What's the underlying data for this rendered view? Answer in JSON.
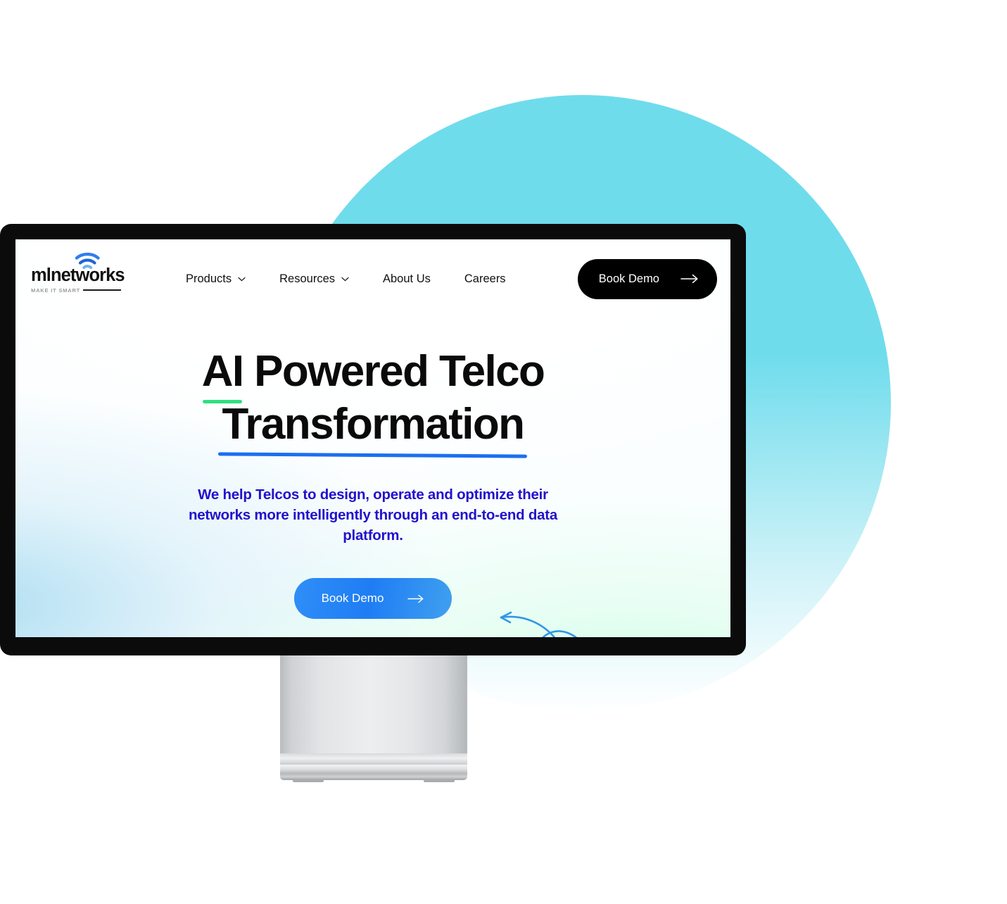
{
  "brand": {
    "name": "mlnetworks",
    "tagline": "MAKE IT SMART",
    "logo_icon": "wifi-signal-icon"
  },
  "nav": {
    "items": [
      {
        "label": "Products",
        "has_dropdown": true,
        "icon": "chevron-down-icon"
      },
      {
        "label": "Resources",
        "has_dropdown": true,
        "icon": "chevron-down-icon"
      },
      {
        "label": "About Us",
        "has_dropdown": false
      },
      {
        "label": "Careers",
        "has_dropdown": false
      }
    ],
    "cta": {
      "label": "Book Demo",
      "icon": "arrow-right-icon",
      "background": "#000000",
      "text_color": "#ffffff"
    }
  },
  "hero": {
    "headline_line1_highlight": "AI",
    "headline_line1_rest": " Powered Telco",
    "headline_line2": "Transformation",
    "underline_green": "#2ee07f",
    "underline_blue": "#1b6ff0",
    "subheading": "We help Telcos to design, operate and optimize their networks more intelligently through an end-to-end data platform.",
    "subheading_color": "#2211cc",
    "cta": {
      "label": "Book Demo",
      "icon": "arrow-right-icon",
      "background": "#2080f5",
      "text_color": "#ffffff"
    },
    "decoration_icon": "curly-arrow-left-icon",
    "decoration_color": "#2f8fe8"
  },
  "decor": {
    "circle_color": "#6fdcec"
  },
  "device": {
    "type": "desktop-monitor",
    "bezel_color": "#0b0b0b",
    "stand_color": "#e2e4e6"
  }
}
